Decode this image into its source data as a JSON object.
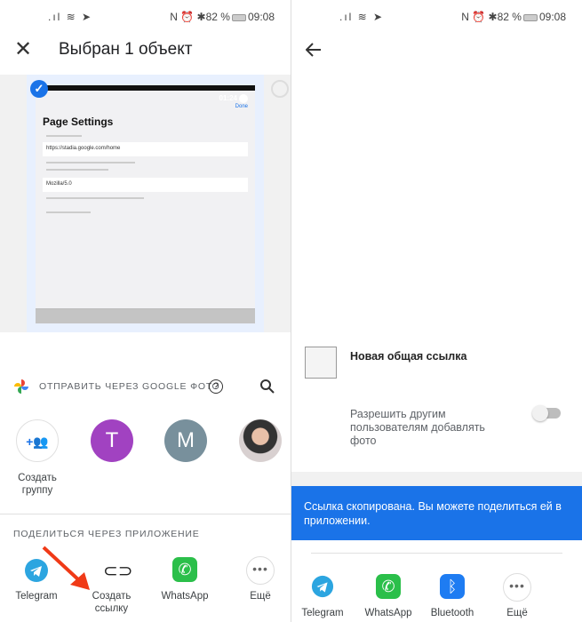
{
  "status_bar": {
    "time": "09:08",
    "battery": "82 %"
  },
  "left": {
    "header": {
      "title": "Выбран 1 объект"
    },
    "preview": {
      "time": "01:24",
      "done": "Done",
      "heading": "Page Settings",
      "url": "https://stadia.google.com/home",
      "user_agent": "Mozilla/5.0"
    },
    "google_photos": {
      "label": "ОТПРАВИТЬ ЧЕРЕЗ GOOGLE ФОТО"
    },
    "contacts": [
      {
        "label": "Создать группу"
      },
      {
        "initial": "T",
        "color": "#a142c1"
      },
      {
        "initial": "M",
        "color": "#78909c"
      },
      {
        "initial": ""
      }
    ],
    "share_section": {
      "label": "ПОДЕЛИТЬСЯ ЧЕРЕЗ ПРИЛОЖЕНИЕ"
    },
    "apps": [
      {
        "label": "Telegram",
        "icon": "telegram-icon"
      },
      {
        "label": "Создать ссылку",
        "icon": "link-icon"
      },
      {
        "label": "WhatsApp",
        "icon": "whatsapp-icon"
      },
      {
        "label": "Ещё",
        "icon": "more-icon"
      }
    ]
  },
  "right": {
    "link": {
      "title": "Новая общая ссылка"
    },
    "toggle": {
      "label": "Разрешить другим пользователям добавлять фото",
      "on": false
    },
    "snackbar": {
      "text": "Ссылка скопирована. Вы можете поделиться ей в приложении."
    },
    "apps": [
      {
        "label": "Telegram",
        "icon": "telegram-icon"
      },
      {
        "label": "WhatsApp",
        "icon": "whatsapp-icon"
      },
      {
        "label": "Bluetooth",
        "icon": "bluetooth-icon"
      },
      {
        "label": "Ещё",
        "icon": "more-icon"
      }
    ]
  },
  "colors": {
    "accent": "#1a73e8",
    "telegram": "#2ca5e0",
    "whatsapp": "#2bbf4a",
    "bluetooth": "#1e7cf2"
  }
}
